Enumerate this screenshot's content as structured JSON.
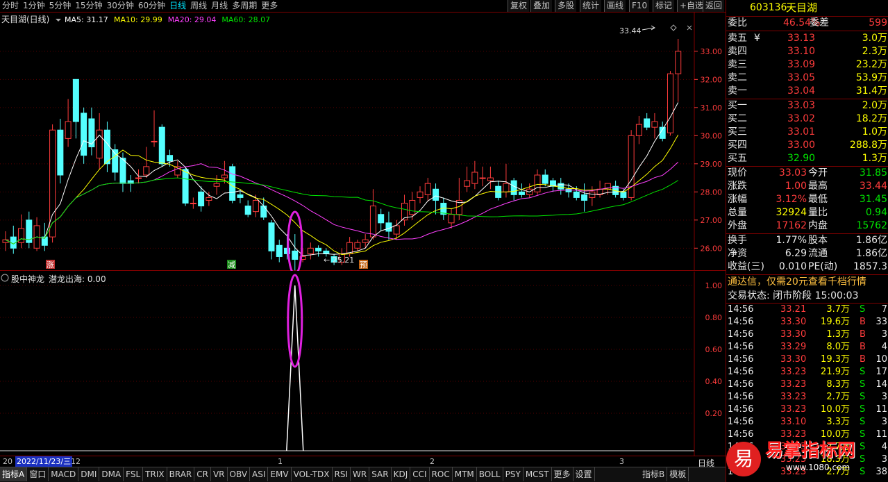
{
  "toolbar": {
    "timeframes": [
      "分时",
      "1分钟",
      "5分钟",
      "15分钟",
      "30分钟",
      "60分钟",
      "日线",
      "周线",
      "月线",
      "多周期",
      "更多"
    ],
    "active_timeframe": "日线",
    "buttons": [
      "复权",
      "叠加",
      "多股",
      "统计",
      "画线",
      "F10",
      "标记",
      "+自选",
      "返回"
    ]
  },
  "main_chart": {
    "title": "天目湖(日线)",
    "ma_labels": [
      {
        "text": "MA5: 31.17",
        "color": "#ffffff"
      },
      {
        "text": "MA10: 29.99",
        "color": "#ffff00"
      },
      {
        "text": "MA20: 29.04",
        "color": "#ff40ff"
      },
      {
        "text": "MA60: 28.07",
        "color": "#00e600"
      }
    ],
    "high_annotation": "33.44",
    "low_annotation": "25.21",
    "markers": [
      "涨",
      "减",
      "预"
    ],
    "y_ticks": [
      "33.00",
      "32.00",
      "31.00",
      "30.00",
      "29.00",
      "28.00",
      "27.00",
      "26.00"
    ]
  },
  "indicator_chart": {
    "title": "股中神龙",
    "label": "潜龙出海: 0.00",
    "y_ticks": [
      "1.00",
      "0.80",
      "0.60",
      "0.40",
      "0.20"
    ]
  },
  "axis_bar": {
    "date_label": "2022/11/23/三",
    "left_frag": "20",
    "after_date": "12",
    "month_marks": [
      "1",
      "2",
      "3"
    ],
    "right_label": "日线"
  },
  "bottom_tabs": [
    "指标A",
    "窗口",
    "MACD",
    "DMI",
    "DMA",
    "FSL",
    "TRIX",
    "BRAR",
    "CR",
    "VR",
    "OBV",
    "ASI",
    "EMV",
    "VOL-TDX",
    "RSI",
    "WR",
    "SAR",
    "KDJ",
    "CCI",
    "ROC",
    "MTM",
    "BOLL",
    "PSY",
    "MCST",
    "更多",
    "设置"
  ],
  "bottom_right_tabs": [
    "指标B",
    "模板"
  ],
  "quote": {
    "code": "603136",
    "name": "天目湖",
    "webi_label": "委比",
    "webi_value": "46.54%",
    "wecha_label": "委差",
    "wecha_value": "599",
    "asks": [
      {
        "label": "卖五",
        "mark": "¥",
        "price": "33.13",
        "vol": "3.0万"
      },
      {
        "label": "卖四",
        "mark": "",
        "price": "33.10",
        "vol": "2.3万"
      },
      {
        "label": "卖三",
        "mark": "",
        "price": "33.09",
        "vol": "23.2万"
      },
      {
        "label": "卖二",
        "mark": "",
        "price": "33.05",
        "vol": "53.9万"
      },
      {
        "label": "卖一",
        "mark": "",
        "price": "33.04",
        "vol": "31.4万"
      }
    ],
    "bids": [
      {
        "label": "买一",
        "price": "33.03",
        "vol": "2.0万"
      },
      {
        "label": "买二",
        "price": "33.02",
        "vol": "18.2万"
      },
      {
        "label": "买三",
        "price": "33.01",
        "vol": "1.0万"
      },
      {
        "label": "买四",
        "price": "33.00",
        "vol": "288.8万"
      },
      {
        "label": "买五",
        "price": "32.90",
        "vol": "1.3万"
      }
    ],
    "stats": [
      {
        "l1": "现价",
        "v1": "33.03",
        "c1": "red",
        "l2": "今开",
        "v2": "31.85",
        "c2": "grn"
      },
      {
        "l1": "涨跌",
        "v1": "1.00",
        "c1": "red",
        "l2": "最高",
        "v2": "33.44",
        "c2": "red"
      },
      {
        "l1": "涨幅",
        "v1": "3.12%",
        "c1": "red",
        "l2": "最低",
        "v2": "31.45",
        "c2": "grn"
      },
      {
        "l1": "总量",
        "v1": "32924",
        "c1": "yel",
        "l2": "量比",
        "v2": "0.94",
        "c2": "grn"
      },
      {
        "l1": "外盘",
        "v1": "17162",
        "c1": "red",
        "l2": "内盘",
        "v2": "15762",
        "c2": "grn"
      }
    ],
    "stats2": [
      {
        "l1": "换手",
        "v1": "1.77%",
        "l2": "股本",
        "v2": "1.86亿"
      },
      {
        "l1": "净资",
        "v1": "6.29",
        "l2": "流通",
        "v2": "1.86亿"
      },
      {
        "l1": "收益(三)",
        "v1": "0.010",
        "l2": "PE(动)",
        "v2": "1857.3"
      }
    ],
    "promo": "通达信，仅需20元查看千档行情",
    "trade_status": "交易状态: 闭市阶段 15:00:03",
    "trades": [
      {
        "t": "14:56",
        "p": "33.21",
        "v": "3.7万",
        "s": "S",
        "n": "7"
      },
      {
        "t": "14:56",
        "p": "33.30",
        "v": "19.6万",
        "s": "B",
        "n": "33"
      },
      {
        "t": "14:56",
        "p": "33.30",
        "v": "1.3万",
        "s": "B",
        "n": "3"
      },
      {
        "t": "14:56",
        "p": "33.29",
        "v": "8.0万",
        "s": "B",
        "n": "4"
      },
      {
        "t": "14:56",
        "p": "33.30",
        "v": "19.3万",
        "s": "B",
        "n": "10"
      },
      {
        "t": "14:56",
        "p": "33.23",
        "v": "21.9万",
        "s": "S",
        "n": "17"
      },
      {
        "t": "14:56",
        "p": "33.23",
        "v": "8.3万",
        "s": "S",
        "n": "14"
      },
      {
        "t": "14:56",
        "p": "33.23",
        "v": "2.7万",
        "s": "S",
        "n": "3"
      },
      {
        "t": "14:56",
        "p": "33.23",
        "v": "10.0万",
        "s": "S",
        "n": "11"
      },
      {
        "t": "14:56",
        "p": "33.10",
        "v": "3.3万",
        "s": "S",
        "n": "3"
      },
      {
        "t": "14:56",
        "p": "33.23",
        "v": "10.0万",
        "s": "S",
        "n": "11"
      },
      {
        "t": "14:56",
        "p": "33.23",
        "v": "2.7万",
        "s": "S",
        "n": "4"
      },
      {
        "t": "14:56",
        "p": "33.23",
        "v": "18.3万",
        "s": "S",
        "n": "3"
      },
      {
        "t": "14:56",
        "p": "33.23",
        "v": "2.7万",
        "s": "S",
        "n": "38"
      }
    ]
  },
  "watermark": {
    "logo_char": "易",
    "text": "易掌指标网",
    "url": "www.1080.com"
  },
  "colors": {
    "up": "#ff3c3c",
    "down": "#54ffff",
    "ma5": "#ffffff",
    "ma10": "#ffff00",
    "ma20": "#ff40ff",
    "ma60": "#00e600",
    "border": "#800000"
  }
}
